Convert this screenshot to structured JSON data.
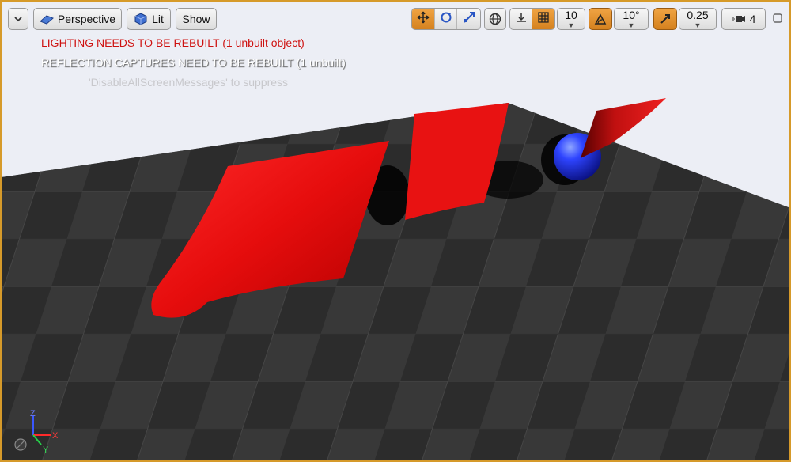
{
  "toolbar": {
    "viewport_menu_label": "",
    "perspective_label": "Perspective",
    "lit_label": "Lit",
    "show_label": "Show",
    "grid_snap_value": "10",
    "rotation_snap_value": "10°",
    "scale_snap_value": "0.25",
    "camera_speed_value": "4"
  },
  "messages": {
    "lighting": "LIGHTING NEEDS TO BE REBUILT (1 unbuilt object)",
    "reflection": "REFLECTION CAPTURES NEED TO BE REBUILT (1 unbuilt)",
    "suppress": "'DisableAllScreenMessages' to suppress"
  },
  "axis": {
    "x": "X",
    "y": "Y",
    "z": "Z"
  },
  "colors": {
    "accent": "#d69a2a",
    "cloth": "#e40d0d",
    "sphere": "#1e2fe0",
    "sky": "#eceef5",
    "warning": "#cc1111"
  },
  "icons": [
    "chevron-down-icon",
    "perspective-icon",
    "lit-icon",
    "translate-icon",
    "rotate-icon",
    "scale-icon",
    "world-icon",
    "surface-snap-icon",
    "grid-icon",
    "rotation-snap-icon",
    "scale-snap-icon",
    "camera-speed-icon",
    "maximize-icon"
  ]
}
